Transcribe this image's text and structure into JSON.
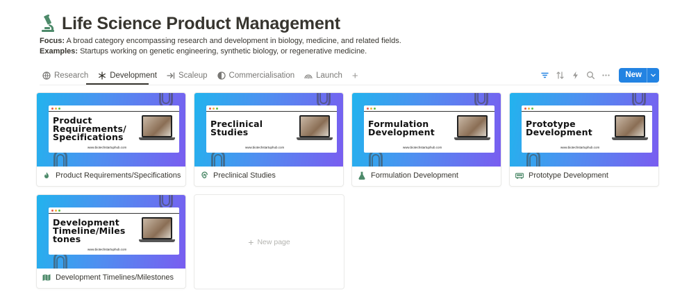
{
  "page": {
    "title": "Life Science Product Management",
    "focus_label": "Focus:",
    "focus_text": " A broad category encompassing research and development in biology, medicine, and related fields.",
    "examples_label": "Examples:",
    "examples_text": " Startups working on genetic engineering, synthetic biology, or regenerative medicine."
  },
  "tabs": [
    {
      "label": "Research",
      "icon": "globe-icon"
    },
    {
      "label": "Development",
      "icon": "snowflake-icon",
      "active": true
    },
    {
      "label": "Scaleup",
      "icon": "arrow-to-line-icon"
    },
    {
      "label": "Commercialisation",
      "icon": "circle-icon"
    },
    {
      "label": "Launch",
      "icon": "rainbow-icon"
    }
  ],
  "toolbar": {
    "new_label": "New",
    "icons": [
      "filter-icon",
      "sort-icon",
      "lightning-icon",
      "search-icon",
      "more-icon",
      "chevron-down-icon"
    ]
  },
  "colors": {
    "accent": "#2383e2",
    "text": "#37352f",
    "muted": "#787774",
    "cover_start": "#22b3ee",
    "cover_end": "#7a5cf0",
    "title_icon": "#4d8a6a"
  },
  "cards": [
    {
      "cover_heading": "Product Requirements/ Specifications",
      "cover_url": "www.biotechstartuphub.com",
      "caption": "Product Requirements/Specifications",
      "icon": "fire-icon",
      "icon_color": "#4d8a6a"
    },
    {
      "cover_heading": "Preclinical Studies",
      "cover_url": "www.biotechstartuphub.com",
      "caption": "Preclinical Studies",
      "icon": "spiral-icon",
      "icon_color": "#4d8a6a"
    },
    {
      "cover_heading": "Formulation Development",
      "cover_url": "www.biotechstartuphub.com",
      "caption": "Formulation Development",
      "icon": "flask-icon",
      "icon_color": "#4d8a6a"
    },
    {
      "cover_heading": "Prototype Development",
      "cover_url": "www.biotechstartuphub.com",
      "caption": "Prototype Development",
      "icon": "truck-icon",
      "icon_color": "#4d8a6a"
    },
    {
      "cover_heading": "Development Timeline/Miles tones",
      "cover_url": "www.biotechstartuphub.com",
      "caption": "Development Timelines/Milestones",
      "icon": "map-icon",
      "icon_color": "#4d8a6a"
    }
  ],
  "new_page_label": "New page"
}
